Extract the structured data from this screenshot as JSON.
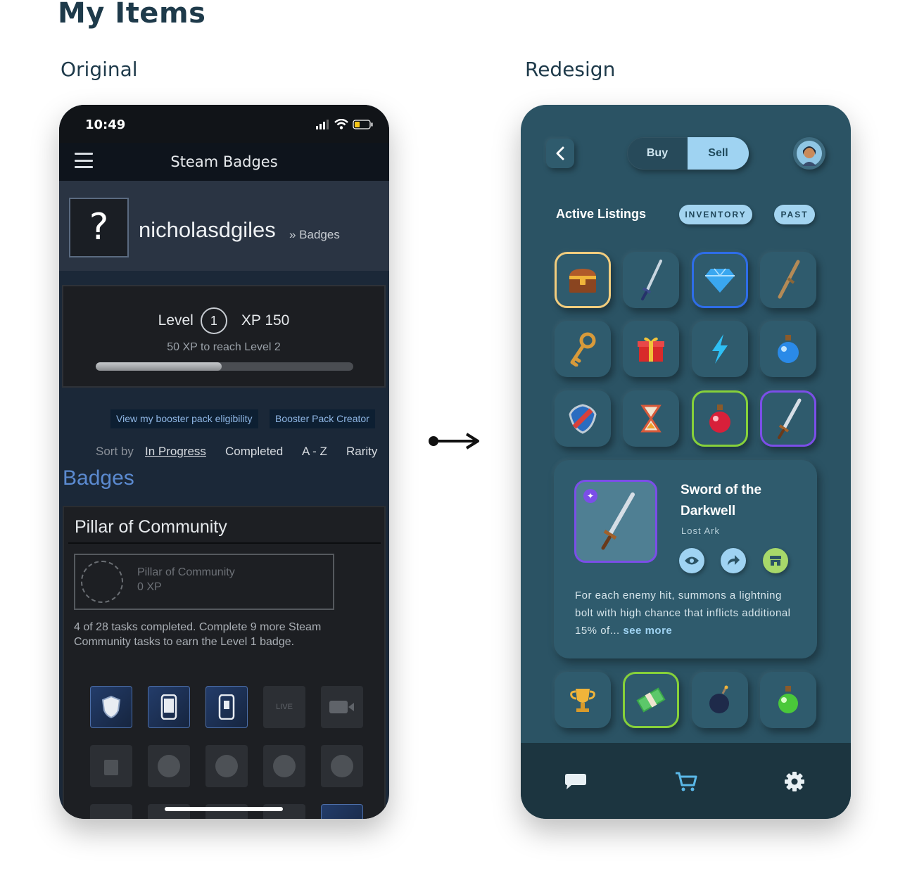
{
  "page": {
    "title": "My Items",
    "original_label": "Original",
    "redesign_label": "Redesign"
  },
  "original": {
    "status": {
      "time": "10:49"
    },
    "nav": {
      "title": "Steam Badges"
    },
    "profile": {
      "avatar_glyph": "?",
      "username": "nicholasdgiles",
      "breadcrumb": "» Badges"
    },
    "level": {
      "label": "Level",
      "number": "1",
      "xp": "XP 150",
      "note": "50 XP to reach Level 2",
      "progress": 0.49
    },
    "buttons": {
      "eligibility": "View my booster pack eligibility",
      "creator": "Booster Pack Creator"
    },
    "sort": {
      "label": "Sort by",
      "options": [
        "In Progress",
        "Completed",
        "A - Z",
        "Rarity"
      ]
    },
    "badges_heading": "Badges",
    "card": {
      "title": "Pillar of Community",
      "badge_name": "Pillar of Community",
      "badge_xp": "0 XP",
      "tasks": "4 of 28 tasks completed. Complete 9 more Steam Community tasks to earn the Level 1 badge.",
      "live_label": "LIVE"
    }
  },
  "redesign": {
    "toggle": {
      "buy": "Buy",
      "sell": "Sell"
    },
    "active_listings": "Active Listings",
    "pills": {
      "inventory": "INVENTORY",
      "past": "PAST"
    },
    "items": [
      "chest-icon",
      "sword-icon",
      "diamond-icon",
      "rifle-icon",
      "key-icon",
      "gift-icon",
      "lightning-icon",
      "potion-blue-icon",
      "shield-icon",
      "hourglass-icon",
      "potion-red-icon",
      "sword-icon",
      "trophy-icon",
      "cash-icon",
      "bomb-icon",
      "potion-green-icon"
    ],
    "detail": {
      "title": "Sword of the Darkwell",
      "game": "Lost Ark",
      "description": "For each enemy hit, summons a lightning bolt with high chance that inflicts additional 15% of...",
      "see_more": "see more"
    },
    "colors": {
      "sell": "#9fd3f2",
      "gold": "#f2cd7e",
      "blue": "#2e6de8",
      "green": "#86d13a",
      "purple": "#7b4ee8"
    }
  }
}
